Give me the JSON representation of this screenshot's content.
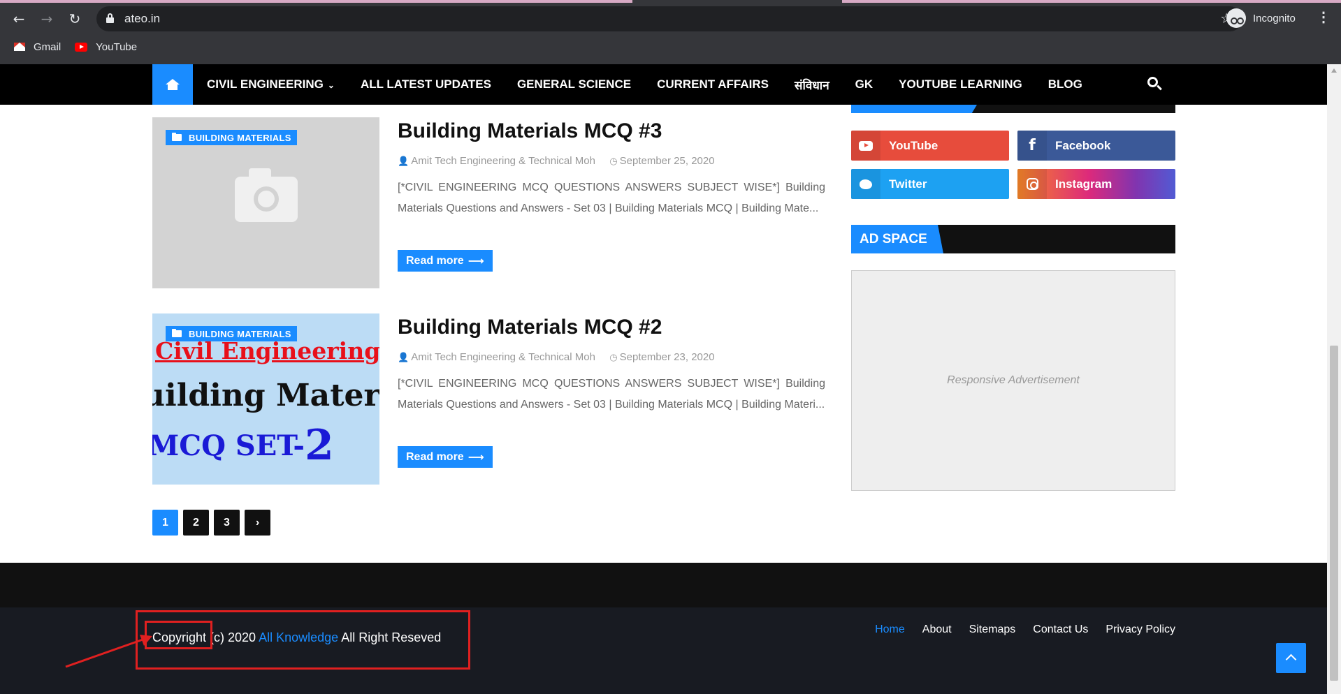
{
  "browser": {
    "url": "ateo.in",
    "profile_label": "Incognito",
    "back_icon": "back-arrow-icon",
    "forward_icon": "forward-arrow-icon",
    "reload_icon": "reload-icon",
    "bookmarks": [
      {
        "label": "Gmail",
        "icon": "gmail-icon"
      },
      {
        "label": "YouTube",
        "icon": "youtube-icon"
      }
    ]
  },
  "nav": {
    "items": [
      {
        "label": "CIVIL ENGINEERING",
        "has_dropdown": true
      },
      {
        "label": "ALL LATEST UPDATES"
      },
      {
        "label": "GENERAL SCIENCE"
      },
      {
        "label": "CURRENT AFFAIRS"
      },
      {
        "label": "संविधान"
      },
      {
        "label": "GK"
      },
      {
        "label": "YOUTUBE LEARNING"
      },
      {
        "label": "BLOG"
      }
    ],
    "dropdown_caret": "⌄"
  },
  "posts": [
    {
      "category": "BUILDING MATERIALS",
      "title": "Building Materials MCQ #3",
      "author": "Amit Tech Engineering & Technical Moh",
      "date": "September 25, 2020",
      "excerpt": "[*CIVIL ENGINEERING MCQ QUESTIONS ANSWERS SUBJECT WISE*] Building Materials Questions and Answers - Set 03 | Building Materials MCQ | Building Mate...",
      "read_more": "Read more",
      "thumbnail": "placeholder-camera"
    },
    {
      "category": "BUILDING MATERIALS",
      "title": "Building Materials MCQ #2",
      "author": "Amit Tech Engineering & Technical Moh",
      "date": "September 23, 2020",
      "excerpt": "[*CIVIL ENGINEERING MCQ QUESTIONS ANSWERS SUBJECT WISE*] Building Materials Questions and Answers - Set 03 | Building Materials MCQ | Building Materi...",
      "read_more": "Read more",
      "thumbnail_text": {
        "line1": "Civil Engineering",
        "line2": "uilding Materia",
        "line3": "MCQ SET-",
        "line3_num": "2"
      }
    }
  ],
  "pagination": {
    "pages": [
      "1",
      "2",
      "3"
    ],
    "current": "1",
    "next": "›"
  },
  "sidebar": {
    "social": [
      {
        "label": "YouTube",
        "color": "#e74c3c"
      },
      {
        "label": "Facebook",
        "color": "#3b5998"
      },
      {
        "label": "Twitter",
        "color": "#1da1f2"
      },
      {
        "label": "Instagram",
        "color": "#c13584"
      }
    ],
    "ad_heading": "AD SPACE",
    "ad_placeholder": "Responsive Advertisement"
  },
  "footer": {
    "copyright_prefix": "Copyright (c) 2020",
    "site_link": "All Knowledge",
    "copyright_suffix": "All Right Reseved",
    "links": [
      "Home",
      "About",
      "Sitemaps",
      "Contact Us",
      "Privacy Policy"
    ],
    "active_link": "Home"
  },
  "colors": {
    "accent": "#1a8cff",
    "annotation": "#e02020",
    "nav_bg": "#000000",
    "footer_bg": "#181b22"
  }
}
